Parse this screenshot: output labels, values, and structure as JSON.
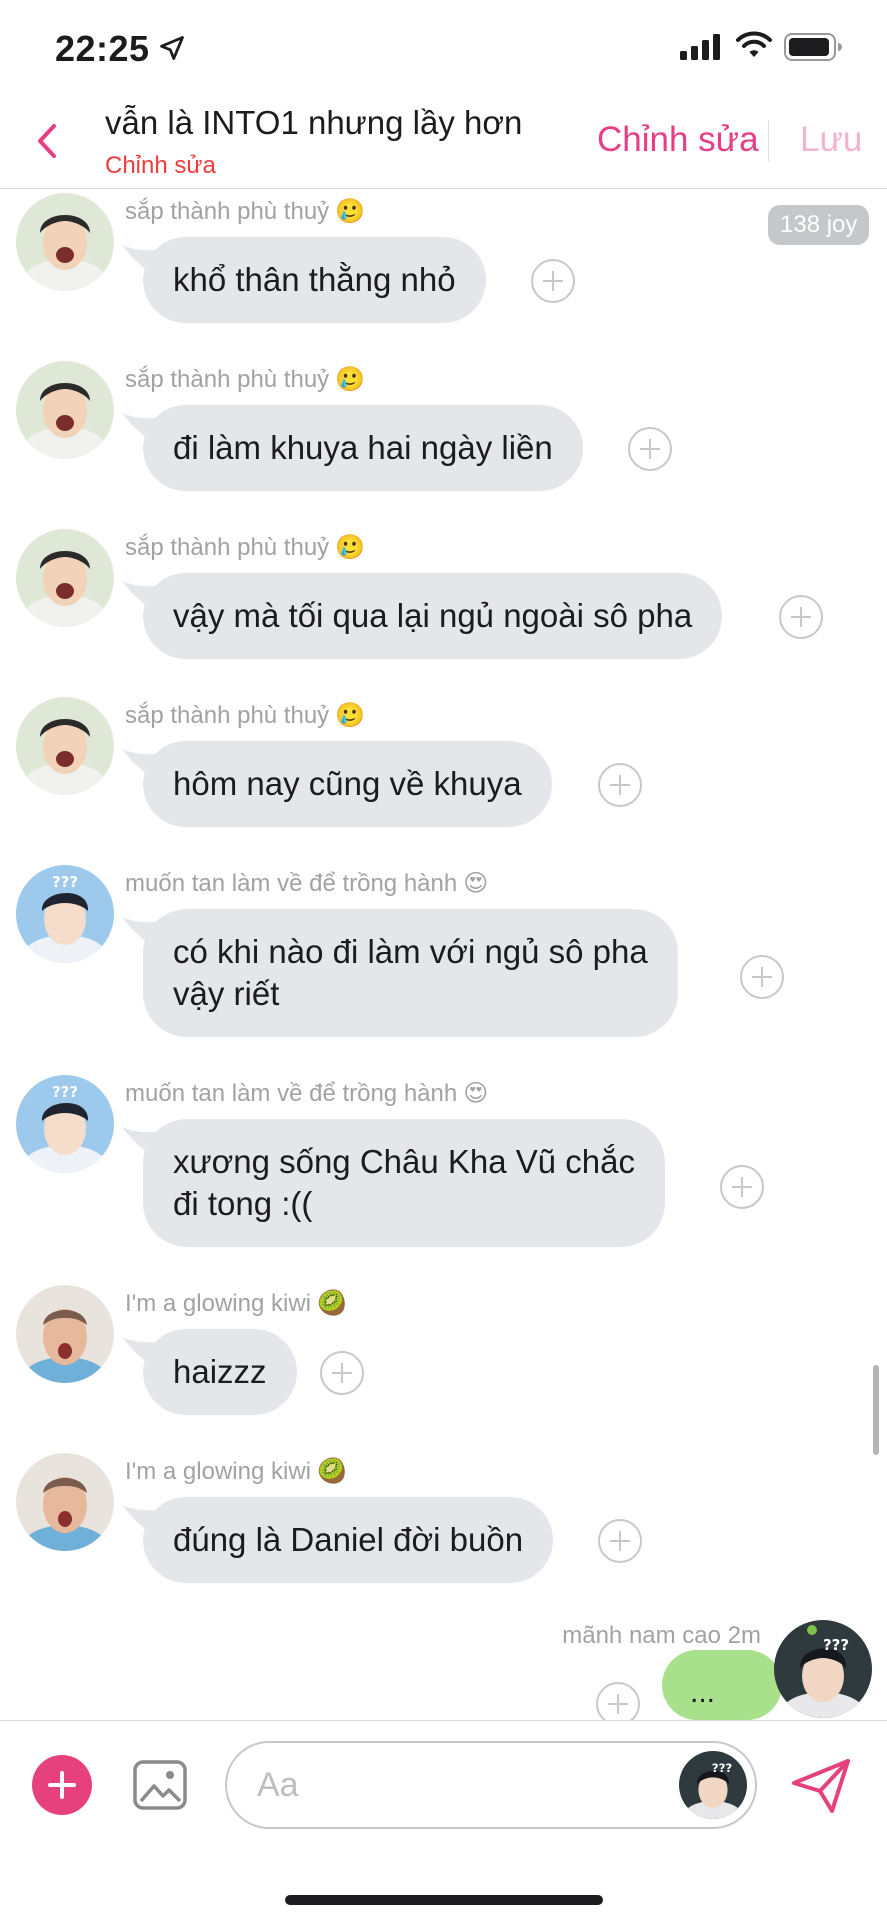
{
  "status_bar": {
    "time": "22:25"
  },
  "header": {
    "title": "vẫn là INTO1 nhưng lầy hơn",
    "subtitle": "Chỉnh sửa",
    "edit_label": "Chỉnh sửa",
    "save_label": "Lưu",
    "accent_color": "#e83e85"
  },
  "joy_badge": "138 joy",
  "messages": [
    {
      "sender": "sắp thành phù thuỷ",
      "emoji": "🥲",
      "text": "khổ thân thằng nhỏ"
    },
    {
      "sender": "sắp thành phù thuỷ",
      "emoji": "🥲",
      "text": "đi làm khuya hai ngày liền"
    },
    {
      "sender": "sắp thành phù thuỷ",
      "emoji": "🥲",
      "text": "vậy mà tối qua lại ngủ ngoài sô pha"
    },
    {
      "sender": "sắp thành phù thuỷ",
      "emoji": "🥲",
      "text": "hôm nay cũng về khuya"
    },
    {
      "sender": "muốn tan làm về để trồng hành",
      "emoji": "😍",
      "text": "có khi nào đi làm với ngủ sô pha\nvậy riết"
    },
    {
      "sender": "muốn tan làm về để trồng hành",
      "emoji": "😍",
      "text": "xương sống Châu Kha Vũ chắc\nđi tong :(("
    },
    {
      "sender": "I'm a glowing kiwi",
      "emoji": "🥝",
      "text": "haizzz"
    },
    {
      "sender": "I'm a glowing kiwi",
      "emoji": "🥝",
      "text": "đúng là Daniel đời buồn"
    }
  ],
  "own_message": {
    "sender": "mãnh nam cao 2m",
    "text": "..."
  },
  "input": {
    "placeholder": "Aa"
  },
  "icons": [
    "location-arrow-icon",
    "signal-icon",
    "wifi-icon",
    "battery-icon",
    "back-chevron-icon",
    "add-reaction-icon",
    "plus-icon",
    "image-icon",
    "send-icon"
  ]
}
